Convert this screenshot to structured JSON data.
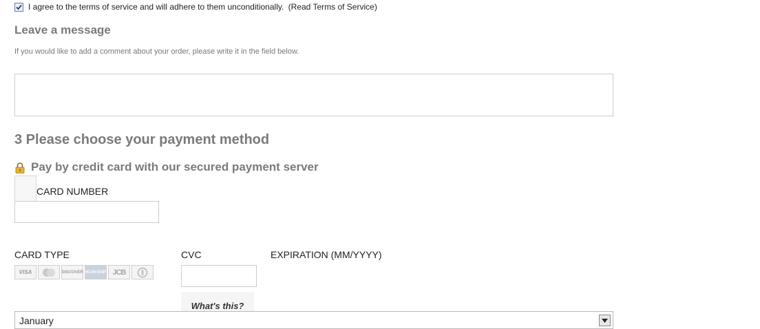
{
  "terms": {
    "checked": true,
    "text": "I agree to the terms of service and will adhere to them unconditionally.",
    "link_label": "(Read Terms of Service)"
  },
  "message": {
    "title": "Leave a message",
    "help": "If you would like to add a comment about your order, please write it in the field below.",
    "value": ""
  },
  "payment": {
    "title": "3 Please choose your payment method",
    "secure_title": "Pay by credit card with our secured payment server",
    "card_number_label": "CARD NUMBER",
    "card_number_value": "",
    "card_type_label": "CARD TYPE",
    "card_logos": [
      "VISA",
      "MasterCard",
      "DISCOVER",
      "AMERICAN EXPRESS",
      "JCB",
      "Diners Club"
    ],
    "card_logo_texts": [
      "VISA",
      "",
      "DISCOVER",
      "AMERICAN EXPRESS",
      "JCB",
      ""
    ],
    "cvc_label": "CVC",
    "cvc_value": "",
    "whats_this": "What's this?",
    "expiration_label": "EXPIRATION (MM/YYYY)",
    "month_selected": "January"
  },
  "icons": {
    "lock": "lock-icon",
    "checkbox_check": "check-icon",
    "dropdown": "chevron-down-icon"
  },
  "colors": {
    "heading": "#7a7a7a",
    "border": "#cccccc"
  }
}
